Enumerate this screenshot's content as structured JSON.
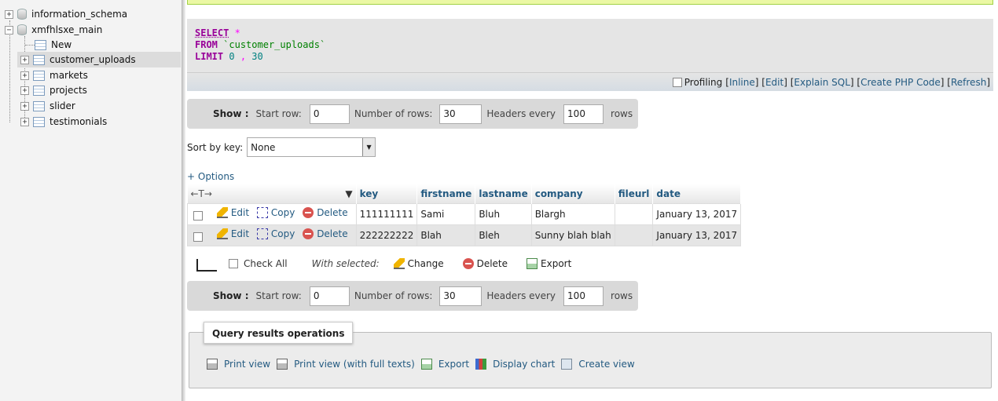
{
  "navigation": {
    "databases": [
      {
        "name": "information_schema",
        "expander": "+"
      },
      {
        "name": "xmfhlsxe_main",
        "expander": "−"
      }
    ],
    "new_label": "New",
    "tables": [
      "customer_uploads",
      "markets",
      "projects",
      "slider",
      "testimonials"
    ],
    "selected_table": "customer_uploads"
  },
  "sql": {
    "select_kw": "SELECT",
    "star": "*",
    "from_kw": "FROM",
    "table": "`customer_uploads`",
    "limit_kw": "LIMIT",
    "offset": "0",
    "comma": ",",
    "count": "30"
  },
  "sql_tools": {
    "profiling": "Profiling",
    "links": [
      "Inline",
      "Edit",
      "Explain SQL",
      "Create PHP Code",
      "Refresh"
    ]
  },
  "show_bar": {
    "show_label": "Show :",
    "start_row_label": "Start row:",
    "start_row_value": "0",
    "num_rows_label": "Number of rows:",
    "num_rows_value": "30",
    "headers_every_label": "Headers every",
    "headers_every_value": "100",
    "rows_label": "rows"
  },
  "sort": {
    "label": "Sort by key:",
    "value": "None"
  },
  "options_link": "+ Options",
  "table": {
    "nav_arrows": "←T→",
    "columns": [
      "key",
      "firstname",
      "lastname",
      "company",
      "fileurl",
      "date"
    ],
    "actions": {
      "edit": "Edit",
      "copy": "Copy",
      "delete": "Delete"
    },
    "rows": [
      {
        "key": "111111111",
        "firstname": "Sami",
        "lastname": "Bluh",
        "company": "Blargh",
        "fileurl": "",
        "date": "January 13, 2017"
      },
      {
        "key": "222222222",
        "firstname": "Blah",
        "lastname": "Bleh",
        "company": "Sunny blah blah",
        "fileurl": "",
        "date": "January 13, 2017"
      }
    ]
  },
  "bulk": {
    "check_all": "Check All",
    "with_selected": "With selected:",
    "change": "Change",
    "delete": "Delete",
    "export": "Export"
  },
  "query_ops": {
    "title": "Query results operations",
    "links": [
      "Print view",
      "Print view (with full texts)",
      "Export",
      "Display chart",
      "Create view"
    ]
  }
}
